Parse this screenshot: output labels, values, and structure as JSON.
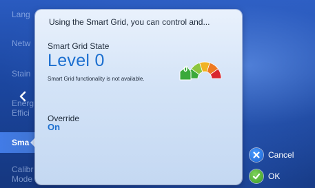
{
  "sidebar": {
    "items": [
      {
        "label": "Lang"
      },
      {
        "label": "Netw"
      },
      {
        "label": "Stain"
      },
      {
        "label": "Energ\nEffici"
      },
      {
        "label": "Sma"
      },
      {
        "label": "Calibr\nMode"
      }
    ],
    "active_index": 4
  },
  "dialog": {
    "title": "Using the Smart Grid, you can control and...",
    "smart_grid_state_label": "Smart Grid State",
    "level_text": "Level 0",
    "description": "Smart Grid functionality is not available.",
    "gauge": {
      "value": "0",
      "segment_colors": [
        "#3aa93a",
        "#8cc63f",
        "#f0b323",
        "#ee7a22",
        "#d9272e"
      ]
    },
    "override_label": "Override",
    "override_value": "On"
  },
  "actions": {
    "cancel_label": "Cancel",
    "ok_label": "OK"
  },
  "colors": {
    "accent_blue": "#1c6fcf",
    "background_blue": "#1b469f",
    "cancel_button": "#1c63d1",
    "ok_button": "#3b9b25"
  },
  "icons": {
    "back": "chevron-left-icon",
    "cancel": "close-icon",
    "ok": "checkmark-icon"
  }
}
